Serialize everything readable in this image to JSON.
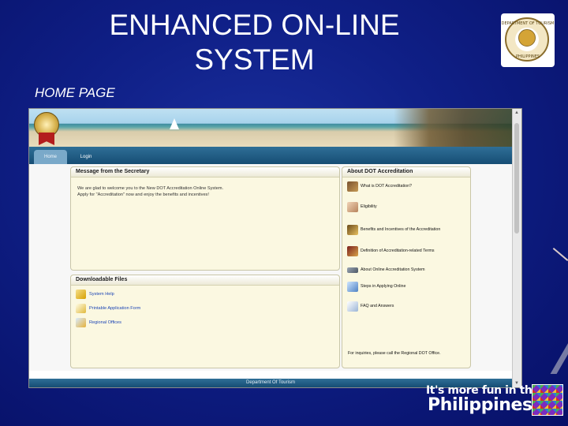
{
  "slide": {
    "title_line1": "ENHANCED ON-LINE",
    "title_line2": "SYSTEM",
    "subtitle": "HOME PAGE"
  },
  "seal": {
    "top": "DEPARTMENT OF TOURISM",
    "bottom": "PHILIPPINES"
  },
  "app": {
    "tabs": [
      "Home",
      "Login"
    ],
    "message_panel": {
      "title": "Message from the Secretary",
      "line1": "We are glad to welcome you to the New DOT Accreditation Online System.",
      "line2": "Apply for \"Accreditation\" now and enjoy the benefits and incentives!"
    },
    "downloadable_panel": {
      "title": "Downloadable Files",
      "items": [
        "System Help",
        "Printable Application Form",
        "Regional Offices"
      ]
    },
    "about_panel": {
      "title": "About DOT Accreditation",
      "items": [
        "What is DOT Accreditation?",
        "Eligibility",
        "Benefits and Incentives of the Accreditation",
        "Definition of Accreditation-related Terms",
        "About Online Accreditation System",
        "Steps in Applying Online",
        "FAQ and Answers"
      ],
      "note": "For inquiries, please call the Regional DOT Office."
    },
    "footer": "Department Of Tourism"
  },
  "branding": {
    "slogan_line1": "It's more fun in the",
    "slogan_line2": "Philippines"
  },
  "colors": {
    "slide_background": "#0f1f86",
    "panel_background": "#fbf8e1",
    "nav_bar": "#1f5f8b",
    "link_blue": "#1b44b5"
  }
}
